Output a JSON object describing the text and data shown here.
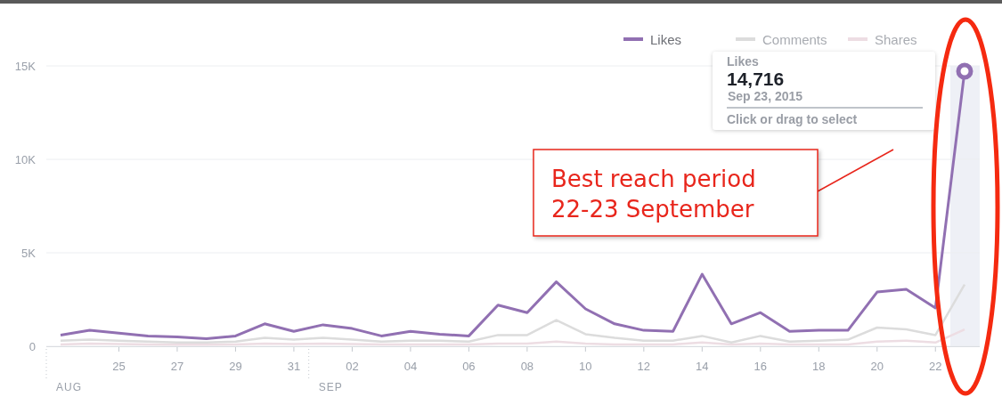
{
  "chart": {
    "chart_data": {
      "type": "line",
      "categories": [
        null,
        null,
        "25",
        null,
        "27",
        null,
        "29",
        null,
        "31",
        null,
        "02",
        null,
        "04",
        null,
        "06",
        null,
        "08",
        null,
        "10",
        null,
        "12",
        null,
        "14",
        null,
        "16",
        null,
        "18",
        null,
        "20",
        null,
        "22",
        null
      ],
      "series": [
        {
          "name": "Likes",
          "color": "#9170b2",
          "values": [
            600,
            850,
            700,
            550,
            500,
            400,
            550,
            1200,
            800,
            1150,
            950,
            550,
            800,
            650,
            550,
            2200,
            1800,
            3450,
            2000,
            1200,
            850,
            800,
            3850,
            1200,
            1800,
            800,
            850,
            850,
            2900,
            3050,
            2050,
            14716
          ]
        },
        {
          "name": "Comments",
          "color": "#dcdcdc",
          "values": [
            300,
            350,
            300,
            250,
            200,
            200,
            250,
            450,
            350,
            450,
            350,
            250,
            300,
            300,
            250,
            600,
            600,
            1400,
            650,
            450,
            300,
            300,
            550,
            200,
            550,
            250,
            300,
            350,
            1000,
            900,
            600,
            3300
          ]
        },
        {
          "name": "Shares",
          "color": "#eddde3",
          "values": [
            100,
            150,
            120,
            100,
            80,
            80,
            100,
            150,
            120,
            150,
            120,
            100,
            100,
            100,
            100,
            150,
            150,
            250,
            150,
            100,
            100,
            100,
            200,
            100,
            150,
            100,
            100,
            100,
            250,
            300,
            200,
            900
          ]
        }
      ],
      "legend": true,
      "ylim": [
        0,
        15000
      ],
      "yticks": [
        {
          "value": 0,
          "label": "0"
        },
        {
          "value": 5000,
          "label": "5K"
        },
        {
          "value": 10000,
          "label": "10K"
        },
        {
          "value": 15000,
          "label": "15K"
        }
      ]
    },
    "month_labels": [
      "AUG",
      "SEP"
    ],
    "tooltip": {
      "series": "Likes",
      "value": "14,716",
      "date": "Sep 23, 2015",
      "hint": "Click or drag to select"
    }
  },
  "callout": {
    "lines": [
      "Best reach period",
      "22-23 September"
    ]
  }
}
